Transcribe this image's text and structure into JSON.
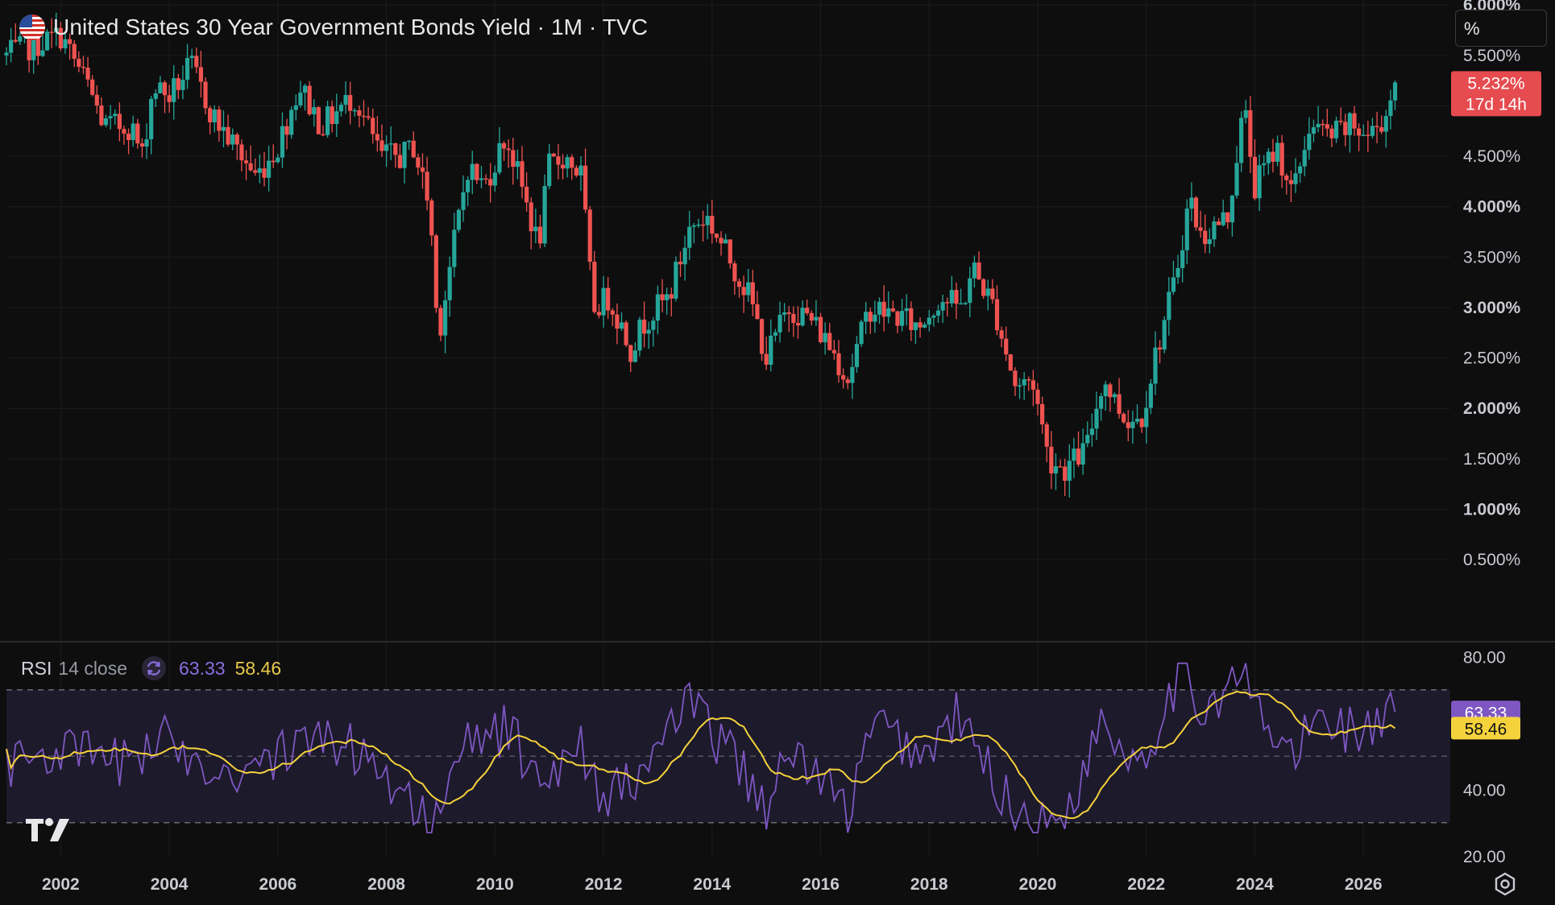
{
  "header": {
    "title": "United States 30 Year Government Bonds Yield · 1M · TVC",
    "unit_label": "%"
  },
  "price_axis": {
    "ticks": [
      "6.000%",
      "5.500%",
      "5.000%",
      "4.500%",
      "4.000%",
      "3.500%",
      "3.000%",
      "2.500%",
      "2.000%",
      "1.500%",
      "1.000%",
      "0.500%"
    ],
    "bold_ticks": [
      "6.000%",
      "4.000%",
      "3.000%",
      "2.000%",
      "1.000%"
    ],
    "last_price_label": "5.232%",
    "countdown_label": "17d 14h"
  },
  "rsi": {
    "name": "RSI",
    "params": "14 close",
    "value": "63.33",
    "ma_value": "58.46",
    "axis_ticks": [
      "80.00",
      "40.00",
      "20.00"
    ],
    "band_levels": [
      70,
      50,
      30
    ]
  },
  "time_axis": {
    "labels": [
      "2002",
      "2004",
      "2006",
      "2008",
      "2010",
      "2012",
      "2014",
      "2016",
      "2018",
      "2020",
      "2022",
      "2024",
      "2026"
    ]
  },
  "colors": {
    "background": "#0e0e0f",
    "up": "#26a69a",
    "down": "#ef5350",
    "rsi_line": "#7e57c2",
    "rsi_ma": "#f5d23c",
    "rsi_band": "#1d1a2b",
    "last_price_bg": "#e54b4f"
  },
  "chart_data": {
    "type": "candlestick",
    "title": "United States 30 Year Government Bonds Yield · 1M · TVC",
    "interval": "1M",
    "ylim": [
      0.2,
      6.0
    ],
    "time_range": [
      "2001-01",
      "2026-08"
    ],
    "anchors": [
      [
        2001.0,
        5.5
      ],
      [
        2001.5,
        5.6
      ],
      [
        2002.0,
        5.7
      ],
      [
        2002.5,
        5.2
      ],
      [
        2002.8,
        4.8
      ],
      [
        2003.3,
        4.8
      ],
      [
        2003.5,
        4.5
      ],
      [
        2003.7,
        5.2
      ],
      [
        2004.0,
        5.1
      ],
      [
        2004.4,
        5.4
      ],
      [
        2004.8,
        4.9
      ],
      [
        2005.2,
        4.6
      ],
      [
        2005.6,
        4.3
      ],
      [
        2006.0,
        4.6
      ],
      [
        2006.4,
        5.2
      ],
      [
        2006.8,
        4.8
      ],
      [
        2007.0,
        4.9
      ],
      [
        2007.4,
        5.1
      ],
      [
        2007.9,
        4.5
      ],
      [
        2008.3,
        4.5
      ],
      [
        2008.5,
        4.6
      ],
      [
        2008.8,
        4.0
      ],
      [
        2008.95,
        2.7
      ],
      [
        2009.2,
        3.5
      ],
      [
        2009.5,
        4.4
      ],
      [
        2009.8,
        4.2
      ],
      [
        2010.2,
        4.7
      ],
      [
        2010.6,
        4.0
      ],
      [
        2010.8,
        3.6
      ],
      [
        2011.0,
        4.4
      ],
      [
        2011.3,
        4.5
      ],
      [
        2011.6,
        4.3
      ],
      [
        2011.8,
        3.0
      ],
      [
        2012.1,
        3.1
      ],
      [
        2012.5,
        2.6
      ],
      [
        2012.8,
        2.9
      ],
      [
        2013.2,
        3.1
      ],
      [
        2013.6,
        3.8
      ],
      [
        2013.9,
        3.9
      ],
      [
        2014.3,
        3.5
      ],
      [
        2014.7,
        3.1
      ],
      [
        2015.0,
        2.5
      ],
      [
        2015.4,
        3.0
      ],
      [
        2015.8,
        2.9
      ],
      [
        2016.2,
        2.6
      ],
      [
        2016.5,
        2.3
      ],
      [
        2016.9,
        3.0
      ],
      [
        2017.5,
        2.9
      ],
      [
        2017.8,
        2.8
      ],
      [
        2018.2,
        3.1
      ],
      [
        2018.6,
        3.0
      ],
      [
        2018.8,
        3.4
      ],
      [
        2019.2,
        3.0
      ],
      [
        2019.6,
        2.2
      ],
      [
        2019.9,
        2.3
      ],
      [
        2020.2,
        1.5
      ],
      [
        2020.5,
        1.4
      ],
      [
        2020.9,
        1.6
      ],
      [
        2021.2,
        2.3
      ],
      [
        2021.6,
        1.9
      ],
      [
        2021.9,
        1.9
      ],
      [
        2022.2,
        2.6
      ],
      [
        2022.5,
        3.2
      ],
      [
        2022.8,
        4.1
      ],
      [
        2023.0,
        3.7
      ],
      [
        2023.5,
        3.9
      ],
      [
        2023.8,
        5.0
      ],
      [
        2024.0,
        4.2
      ],
      [
        2024.4,
        4.6
      ],
      [
        2024.7,
        4.1
      ],
      [
        2025.0,
        4.8
      ],
      [
        2025.4,
        4.7
      ],
      [
        2025.8,
        4.8
      ],
      [
        2026.1,
        4.7
      ],
      [
        2026.4,
        4.9
      ],
      [
        2026.6,
        5.232
      ]
    ],
    "rsi_anchors": [
      [
        2001.0,
        48
      ],
      [
        2002.0,
        52
      ],
      [
        2003.0,
        48
      ],
      [
        2004.0,
        55
      ],
      [
        2005.0,
        45
      ],
      [
        2006.0,
        50
      ],
      [
        2007.0,
        56
      ],
      [
        2008.0,
        45
      ],
      [
        2008.95,
        28
      ],
      [
        2009.5,
        55
      ],
      [
        2010.3,
        58
      ],
      [
        2010.8,
        40
      ],
      [
        2011.5,
        56
      ],
      [
        2012.0,
        38
      ],
      [
        2012.6,
        42
      ],
      [
        2013.5,
        66
      ],
      [
        2014.5,
        48
      ],
      [
        2015.0,
        35
      ],
      [
        2015.5,
        52
      ],
      [
        2016.5,
        33
      ],
      [
        2017.0,
        60
      ],
      [
        2017.9,
        50
      ],
      [
        2018.5,
        62
      ],
      [
        2019.5,
        35
      ],
      [
        2020.2,
        28
      ],
      [
        2020.8,
        42
      ],
      [
        2021.2,
        64
      ],
      [
        2021.6,
        50
      ],
      [
        2022.0,
        52
      ],
      [
        2022.6,
        75
      ],
      [
        2023.0,
        65
      ],
      [
        2023.8,
        74
      ],
      [
        2024.2,
        58
      ],
      [
        2024.7,
        50
      ],
      [
        2025.2,
        62
      ],
      [
        2025.8,
        58
      ],
      [
        2026.2,
        58
      ],
      [
        2026.6,
        63.33
      ]
    ],
    "rsi_ylim": [
      20,
      80
    ]
  }
}
